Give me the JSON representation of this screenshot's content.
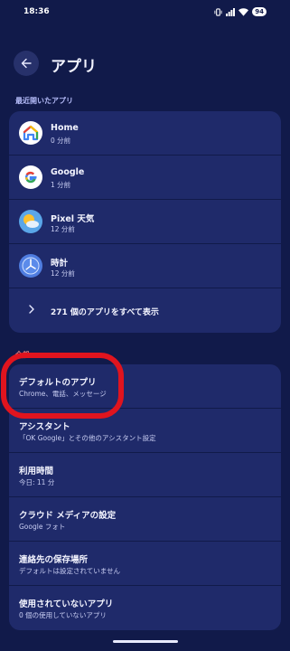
{
  "status_bar": {
    "time": "18:36",
    "battery": "94"
  },
  "header": {
    "title": "アプリ"
  },
  "recent": {
    "label": "最近開いたアプリ",
    "apps": [
      {
        "name": "Home",
        "time": "0 分前",
        "icon": "google-home-icon"
      },
      {
        "name": "Google",
        "time": "1 分前",
        "icon": "google-g-icon"
      },
      {
        "name": "Pixel 天気",
        "time": "12 分前",
        "icon": "weather-icon"
      },
      {
        "name": "時計",
        "time": "12 分前",
        "icon": "clock-icon"
      }
    ],
    "show_all": "271 個のアプリをすべて表示"
  },
  "general": {
    "label": "全般",
    "items": [
      {
        "title": "デフォルトのアプリ",
        "subtitle": "Chrome、電話、メッセージ"
      },
      {
        "title": "アシスタント",
        "subtitle": "「OK Google」とその他のアシスタント設定"
      },
      {
        "title": "利用時間",
        "subtitle": "今日: 11 分"
      },
      {
        "title": "クラウド メディアの設定",
        "subtitle": "Google フォト"
      },
      {
        "title": "連絡先の保存場所",
        "subtitle": "デフォルトは設定されていません"
      },
      {
        "title": "使用されていないアプリ",
        "subtitle": "0 個の使用していないアプリ"
      }
    ]
  },
  "colors": {
    "background": "#111a4a",
    "card": "#1f2a6a",
    "highlight": "#e0141e",
    "accent": "#b6bdfa"
  }
}
